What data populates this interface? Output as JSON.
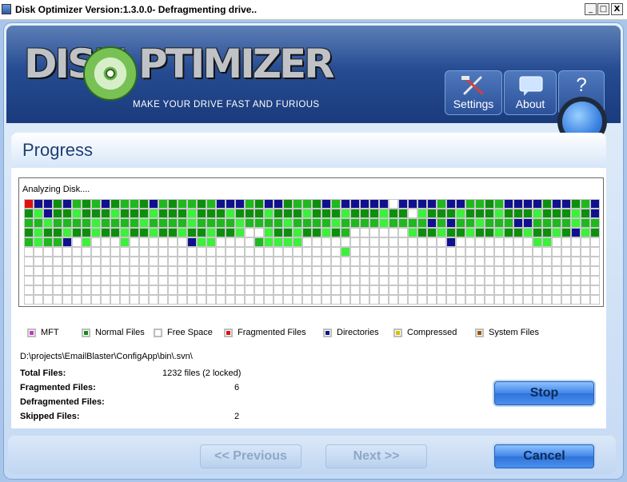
{
  "window": {
    "title": "Disk Optimizer Version:1.3.0.0- Defragmenting drive..",
    "minimize_glyph": "_",
    "maximize_glyph": "□",
    "close_glyph": "X"
  },
  "header": {
    "logo_left": "DISK",
    "logo_right": "PTIMIZER",
    "tagline": "MAKE YOUR DRIVE FAST AND FURIOUS",
    "buttons": [
      {
        "label": "Settings",
        "icon": "tools-icon"
      },
      {
        "label": "About",
        "icon": "speech-bubble-icon"
      },
      {
        "label": "Help",
        "icon": "question-mark-icon",
        "glyph": "?"
      }
    ]
  },
  "section": {
    "title": "Progress"
  },
  "disk_map": {
    "status": "Analyzing Disk....",
    "cell_colors": {
      "mft": "#c03bc0",
      "normal": "#1fb81f",
      "normal_dark": "#0d8f0d",
      "free": "#ffffff",
      "fragmented": "#e01010",
      "directories": "#10108f",
      "compressed": "#d8c000",
      "system": "#a05000",
      "moving": "#3cf03c"
    }
  },
  "legend": [
    {
      "label": "MFT",
      "color": "#c03bc0"
    },
    {
      "label": "Normal Files",
      "color": "#0d8f0d"
    },
    {
      "label": "Free Space",
      "color": "#ffffff"
    },
    {
      "label": "Fragmented Files",
      "color": "#e01010"
    },
    {
      "label": "Directories",
      "color": "#10108f"
    },
    {
      "label": "Compressed",
      "color": "#d8c000"
    },
    {
      "label": "System Files",
      "color": "#a05000"
    }
  ],
  "current_path": "D:\\projects\\EmailBlaster\\ConfigApp\\bin\\.svn\\",
  "stats": {
    "total_label": "Total Files:",
    "total_value": "1232 files (2 locked)",
    "fragmented_label": "Fragmented Files:",
    "fragmented_value": "6",
    "defragmented_label": "Defragmented Files:",
    "defragmented_value": "",
    "skipped_label": "Skipped Files:",
    "skipped_value": "2"
  },
  "buttons": {
    "stop": "Stop",
    "previous": "<< Previous",
    "next": "Next >>",
    "cancel": "Cancel"
  }
}
